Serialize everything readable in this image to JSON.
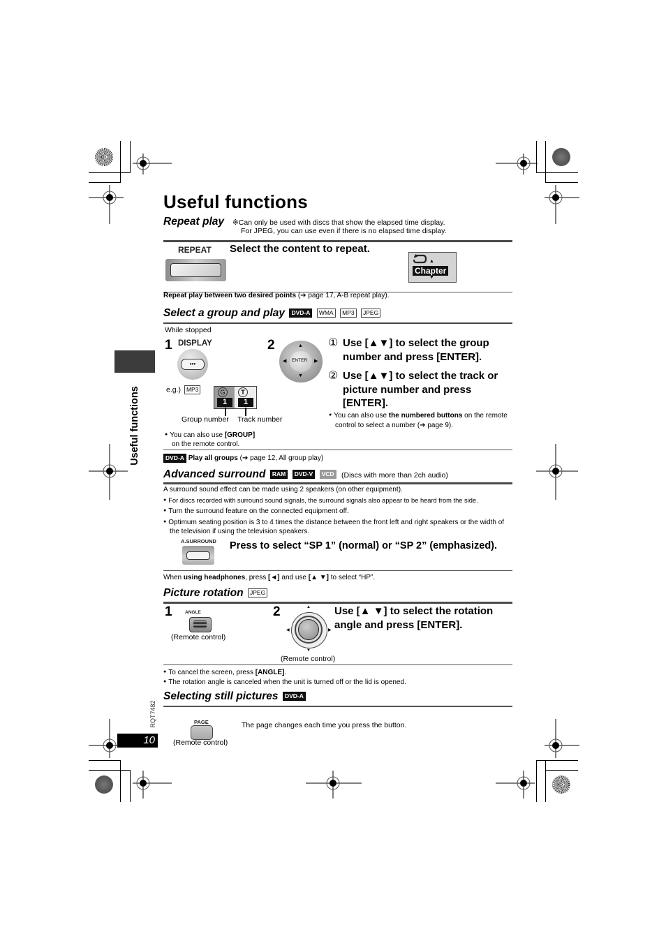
{
  "page": {
    "title": "Useful functions",
    "side_tab": "Useful functions",
    "page_number": "10",
    "model_code": "RQT7482"
  },
  "repeat_play": {
    "heading": "Repeat play",
    "note_line1": "※Can only be used with discs that show the elapsed time display.",
    "note_line2": "For JPEG, you can use even if there is no elapsed time display.",
    "button_label": "REPEAT",
    "instruction": "Select the content to repeat.",
    "display_mode": "Chapter",
    "ab_bold": "Repeat play between two desired points",
    "ab_rest": " (➔ page 17, A-B repeat play)."
  },
  "group_play": {
    "heading": "Select a group and play",
    "tags": [
      "DVD-A",
      "WMA",
      "MP3",
      "JPEG"
    ],
    "condition": "While stopped",
    "step1_num": "1",
    "step1_button": "DISPLAY",
    "step1_button_glyph": "•••",
    "eg_label": "e.g.)",
    "eg_tag": "MP3",
    "group_value": "1",
    "track_value": "1",
    "group_caption": "Group number",
    "track_caption": "Track number",
    "group_icon_letter": "G",
    "track_icon_letter": "T",
    "step1_note_pre": "You can also use ",
    "step1_note_bold": "[GROUP]",
    "step1_note_post": "on the remote control.",
    "step2_num": "2",
    "enter_label": "ENTER",
    "sub1_marker": "①",
    "sub1_text": "Use [▲▼] to select the group number and press [ENTER].",
    "sub2_marker": "②",
    "sub2_text": "Use [▲▼] to select the track or picture number and press [ENTER].",
    "step2_note_pre": "You can also use ",
    "step2_note_bold": "the numbered buttons",
    "step2_note_post": " on the remote control to select a number (➔ page 9).",
    "play_all_tag": "DVD-A",
    "play_all_bold": "Play all groups",
    "play_all_rest": " (➔ page 12, All group play)"
  },
  "advanced_surround": {
    "heading": "Advanced surround",
    "tags": [
      "RAM",
      "DVD-V",
      "VCD"
    ],
    "heading_note": "(Discs with more than 2ch audio)",
    "intro": "A surround sound effect can be made using 2 speakers (on other equipment).",
    "bullets": [
      "For discs recorded with surround sound signals, the surround signals also appear to be heard from the side.",
      "Turn the surround feature on the connected equipment off.",
      "Optimum seating position is 3 to 4 times the distance between the front left and right speakers or the width of the television if using the television speakers."
    ],
    "button_label": "A.SURROUND",
    "instruction": "Press to select “SP 1” (normal) or “SP 2” (emphasized).",
    "hp_pre": "When ",
    "hp_bold1": "using headphones",
    "hp_mid": ", press ",
    "hp_bold2": "[◄]",
    "hp_mid2": " and use ",
    "hp_bold3": "[▲ ▼]",
    "hp_post": " to select “HP”."
  },
  "picture_rotation": {
    "heading": "Picture rotation",
    "tags": [
      "JPEG"
    ],
    "step1_num": "1",
    "step1_button": "ANGLE",
    "step1_caption": "(Remote control)",
    "step2_num": "2",
    "step2_caption": "(Remote control)",
    "instruction": "Use [▲ ▼] to select the rotation angle and press [ENTER].",
    "note1_pre": "To cancel the screen, press ",
    "note1_bold": "[ANGLE]",
    "note1_post": ".",
    "note2": "The rotation angle is canceled when the unit is turned off or the lid is opened."
  },
  "still_pictures": {
    "heading": "Selecting still pictures",
    "tags": [
      "DVD-A"
    ],
    "button_label": "PAGE",
    "caption": "(Remote control)",
    "description": "The page changes each time you press the button."
  }
}
